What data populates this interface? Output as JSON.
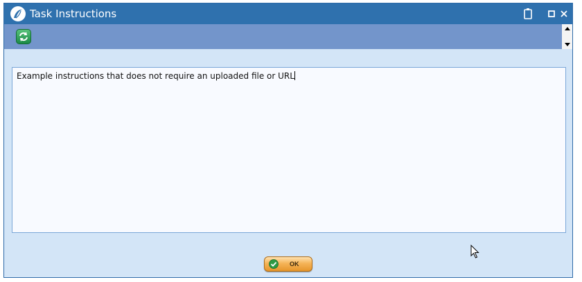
{
  "window": {
    "title": "Task Instructions",
    "controls": [
      "clipboard-icon",
      "maximize-icon",
      "close-icon"
    ]
  },
  "toolbar": {
    "refresh_icon": "refresh-icon"
  },
  "instructions": {
    "text": "Example instructions that does not require an uploaded file or URL"
  },
  "footer": {
    "ok_label": "OK"
  },
  "colors": {
    "titlebar": "#2f71ae",
    "toolbar": "#7395cb",
    "body": "#d3e5f7",
    "ok_button": "#f5b458",
    "refresh_button": "#1b8a46"
  }
}
